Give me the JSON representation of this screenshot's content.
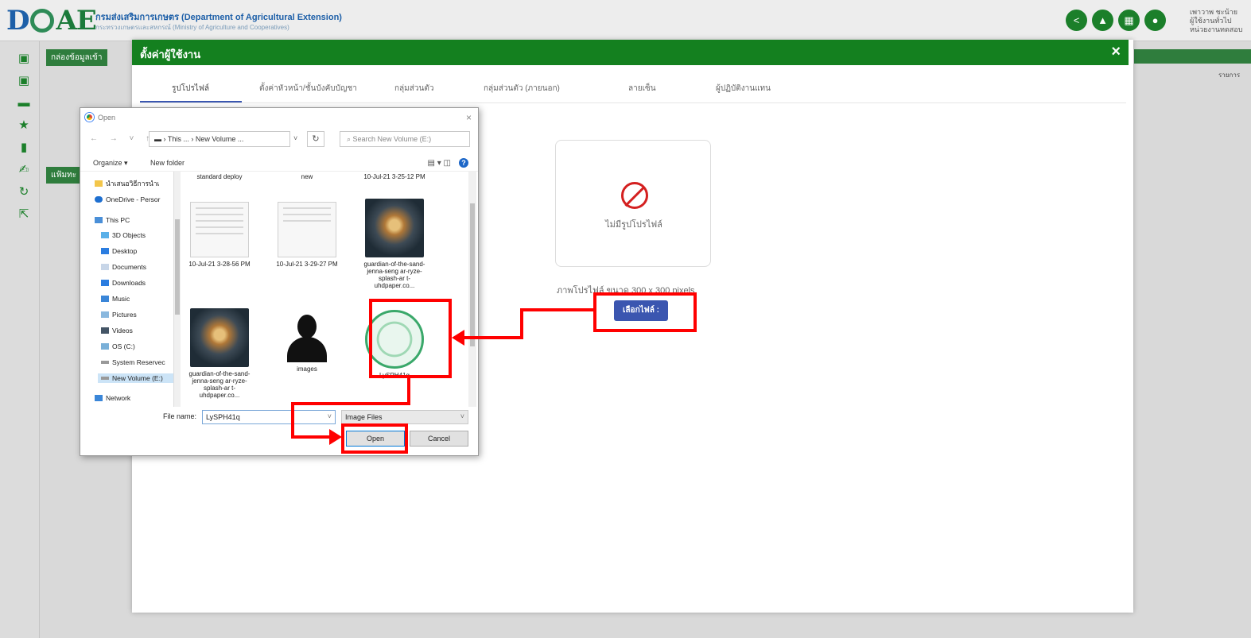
{
  "header": {
    "logo": {
      "d": "D",
      "ae": "AE"
    },
    "org_th": "กรมส่งเสริมการเกษตร (Department of Agricultural Extension)",
    "org_en": "กระทรวงเกษตรและสหกรณ์ (Ministry of Agriculture and Cooperatives)",
    "icons": [
      "share-icon",
      "bell-icon",
      "apps-icon",
      "user-icon"
    ],
    "icon_glyphs": [
      "<",
      "▲",
      "▦",
      "●"
    ],
    "user_line1": "เพาวาพ ชะน้าย",
    "user_line2": "ผู้ใช้งานทั่วไป",
    "user_line3": "หน่วยงานทดสอบ"
  },
  "sidebar": {
    "icons": [
      {
        "name": "inbox-icon",
        "glyph": "▣"
      },
      {
        "name": "outbox-icon",
        "glyph": "▣"
      },
      {
        "name": "folder-icon",
        "glyph": "▬"
      },
      {
        "name": "star-icon",
        "glyph": "★"
      },
      {
        "name": "trash-icon",
        "glyph": "▮"
      },
      {
        "name": "sign-icon",
        "glyph": "✍"
      },
      {
        "name": "refresh-icon",
        "glyph": "↻"
      },
      {
        "name": "external-link-icon",
        "glyph": "⇱"
      }
    ]
  },
  "background": {
    "tab1": "กล่องข้อมูลเข้า",
    "tab2": "แฟ้มทะ",
    "right_label": "รายการ"
  },
  "modal": {
    "title": "ตั้งค่าผู้ใช้งาน",
    "close": "×",
    "tabs": [
      "รูปโปรไฟล์",
      "ตั้งค่าหัวหน้า/ชั้นบังคับบัญชา",
      "กลุ่มส่วนตัว",
      "กลุ่มส่วนตัว (ภายนอก)",
      "ลายเซ็น",
      "ผู้ปฏิบัติงานแทน"
    ],
    "no_profile_text": "ไม่มีรูปโปรไฟล์",
    "hint_text": "ภาพโปรไฟล์ ขนาด 300 x 300 pixels",
    "choose_button": "เลือกไฟล์ :"
  },
  "open_dialog": {
    "title": "Open",
    "close": "×",
    "nav": "← → ˅ ↑",
    "address": "▬ › This ... › New Volume ...",
    "address_chevron": "˅",
    "refresh": "↻",
    "search_placeholder": "⌕ Search New Volume (E:)",
    "organize": "Organize ▾",
    "new_folder": "New folder",
    "view_icons": "▤ ▾  ◫",
    "help": "?",
    "nav_items": [
      "นำเสนอวิธีการนำเ",
      "OneDrive - Persor",
      "This PC",
      "3D Objects",
      "Desktop",
      "Documents",
      "Downloads",
      "Music",
      "Pictures",
      "Videos",
      "OS (C:)",
      "System Reservec",
      "New Volume (E:)",
      "Network"
    ],
    "files_top_row": [
      "standard deploy",
      "new",
      "10-Jul-21 3-25-12 PM"
    ],
    "files": [
      {
        "label": "10-Jul-21 3-28-56 PM"
      },
      {
        "label": "10-Jul-21 3-29-27 PM"
      },
      {
        "label": "guardian-of-the-sand-jenna-seng ar-ryze-splash-ar t-uhdpaper.co..."
      },
      {
        "label": "guardian-of-the-sand-jenna-seng ar-ryze-splash-ar t-uhdpaper.co..."
      },
      {
        "label": "images"
      },
      {
        "label": "LySPH41q"
      }
    ],
    "file_name_label": "File name:",
    "file_name_value": "LySPH41q",
    "file_type": "Image Files",
    "open_button": "Open",
    "cancel_button": "Cancel"
  },
  "annotation_color": "#ff0000"
}
